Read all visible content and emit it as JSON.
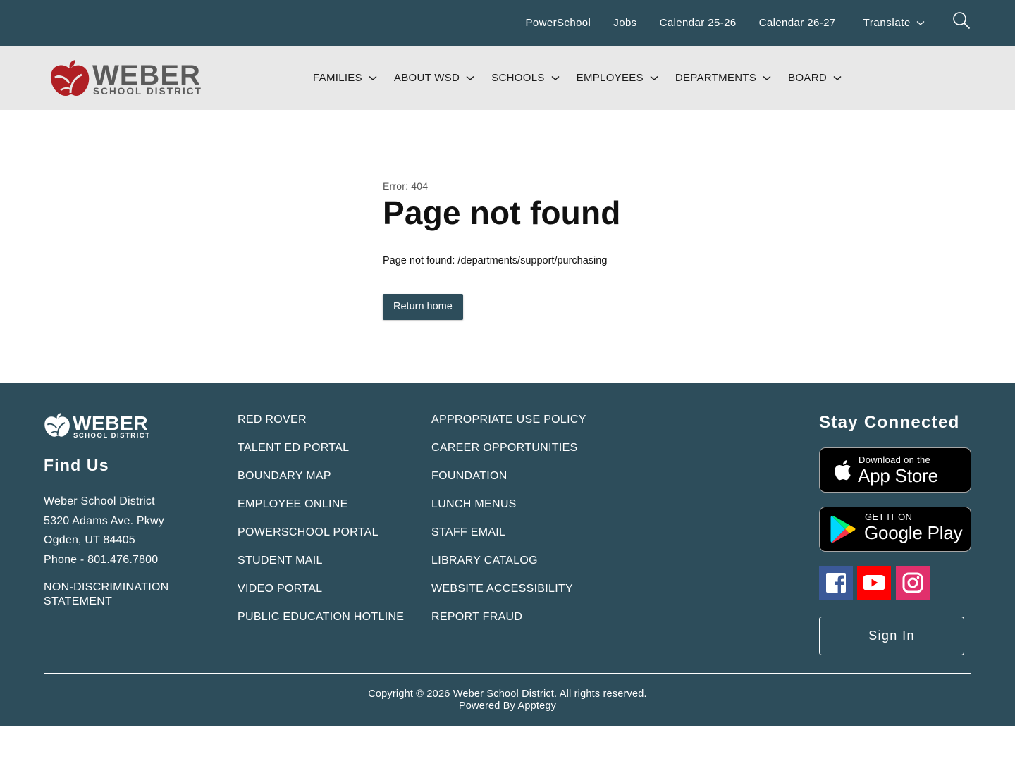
{
  "topbar": {
    "links": [
      "PowerSchool",
      "Jobs",
      "Calendar 25-26",
      "Calendar 26-27"
    ],
    "translate_label": "Translate"
  },
  "header": {
    "logo_word": "WEBER",
    "logo_sub": "SCHOOL DISTRICT",
    "nav": [
      "FAMILIES",
      "ABOUT WSD",
      "SCHOOLS",
      "EMPLOYEES",
      "DEPARTMENTS",
      "BOARD"
    ]
  },
  "main": {
    "error_code": "Error: 404",
    "title": "Page not found",
    "message": "Page not found: /departments/support/purchasing",
    "return_label": "Return home"
  },
  "footer": {
    "logo_word": "WEBER",
    "logo_sub": "SCHOOL DISTRICT",
    "find_title": "Find Us",
    "address_name": "Weber School District",
    "address_street": "5320 Adams Ave. Pkwy",
    "address_city": "Ogden, UT 84405",
    "phone_prefix": "Phone - ",
    "phone": "801.476.7800",
    "nondiscrimination": "NON-DISCRIMINATION STATEMENT",
    "links_col1": [
      "RED ROVER",
      "TALENT ED PORTAL",
      "BOUNDARY MAP",
      "EMPLOYEE ONLINE",
      "POWERSCHOOL PORTAL",
      "STUDENT MAIL",
      "VIDEO PORTAL",
      "PUBLIC EDUCATION HOTLINE"
    ],
    "links_col2": [
      "APPROPRIATE USE POLICY",
      "CAREER OPPORTUNITIES",
      "FOUNDATION",
      "LUNCH MENUS",
      "STAFF EMAIL",
      "LIBRARY CATALOG",
      "WEBSITE ACCESSIBILITY",
      "REPORT FRAUD"
    ],
    "stay_title": "Stay Connected",
    "appstore_small": "Download on the",
    "appstore_big": "App Store",
    "gplay_small": "GET IT ON",
    "gplay_big": "Google Play",
    "signin_label": "Sign In",
    "copyright": "Copyright © 2026 Weber School District. All rights reserved.",
    "powered": "Powered By Apptegy"
  },
  "icons": {
    "search": "search-icon",
    "chevron": "chevron-down-icon",
    "apple": "apple-icon",
    "play": "google-play-icon",
    "facebook": "facebook-icon",
    "youtube": "youtube-icon",
    "instagram": "instagram-icon"
  },
  "colors": {
    "brand_dark": "#2d4d5b",
    "header_bg": "#e8e8e8",
    "apple_red": "#b01f24",
    "facebook": "#3b5998",
    "youtube": "#ff0000",
    "instagram": "#e1306c"
  }
}
